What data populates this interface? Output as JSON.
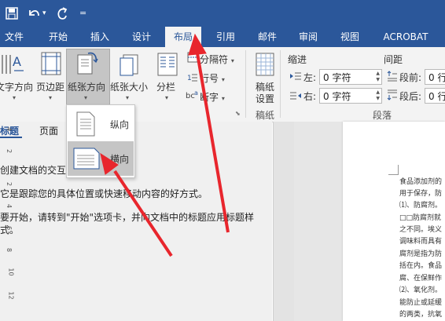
{
  "quick_access": {
    "save_icon": "save-icon",
    "undo_icon": "undo-icon",
    "undo_dropdown": "▾",
    "redo_icon": "redo-icon",
    "customize": "="
  },
  "tabs": [
    {
      "label": "文件"
    },
    {
      "label": "开始"
    },
    {
      "label": "插入"
    },
    {
      "label": "设计"
    },
    {
      "label": "布局",
      "active": true
    },
    {
      "label": "引用"
    },
    {
      "label": "邮件"
    },
    {
      "label": "审阅"
    },
    {
      "label": "视图"
    },
    {
      "label": "ACROBAT"
    }
  ],
  "ribbon": {
    "text_direction": "文字方向",
    "margins": "页边距",
    "orientation": "纸张方向",
    "size": "纸张大小",
    "columns": "分栏",
    "breaks": "分隔符",
    "line_numbers": "行号",
    "hyphenation": "断字",
    "manuscript_line1": "稿纸",
    "manuscript_line2": "设置",
    "manuscript_group": "稿纸",
    "indent_title": "缩进",
    "indent_left_label": "左:",
    "indent_left_value": "0 字符",
    "indent_right_label": "右:",
    "indent_right_value": "0 字符",
    "spacing_title": "间距",
    "spacing_before_label": "段前:",
    "spacing_before_value": "0 行",
    "spacing_after_label": "段后:",
    "spacing_after_value": "0 行",
    "paragraph_group": "段落"
  },
  "orientation_dropdown": {
    "portrait": "纵向",
    "landscape": "横向",
    "selected": "landscape"
  },
  "nav_pane": {
    "tab_headings": "标题",
    "tab_pages": "页面",
    "line1": "创建文档的交互",
    "line2": "它是跟踪您的具体位置或快速移动内容的好方式。",
    "line3": "要开始，请转到\"开始\"选项卡，并向文档中的标题应用标题样",
    "line4": "式。"
  },
  "ruler_numbers": [
    "4",
    "2",
    "2",
    "4",
    "6",
    "8",
    "10",
    "12"
  ],
  "document_lines": [
    "食品添加剂的",
    "用于保存，防",
    "⑴、防腐剂。",
    "□□防腐剂就",
    "之不同。埃义",
    "调味料而具有",
    "腐剂是指为防",
    "括在内。食品",
    "腐、在保鲜作",
    "⑵、氧化剂。",
    "能防止或延缓",
    "的两类，抗氧"
  ],
  "colors": {
    "accent": "#2b579a",
    "annotation_arrow": "#e8262d"
  }
}
